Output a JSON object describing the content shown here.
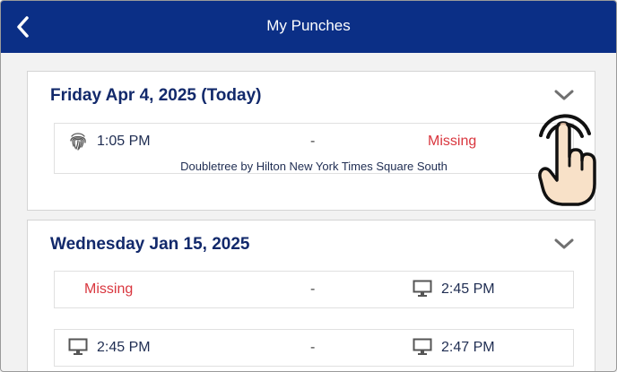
{
  "header": {
    "title": "My Punches",
    "back_icon": "chevron-left-icon"
  },
  "colors": {
    "header_bg": "#0b2f86",
    "date_text": "#12296b",
    "missing": "#d9363e"
  },
  "days": [
    {
      "date": "Friday Apr 4, 2025 (Today)",
      "expand_icon": "chevron-down-icon",
      "punches": [
        {
          "in_icon": "fingerprint-icon",
          "in_time": "1:05 PM",
          "separator": "-",
          "out_time": "Missing",
          "location": "Doubletree by Hilton New York Times Square South"
        }
      ]
    },
    {
      "date": "Wednesday Jan 15, 2025",
      "expand_icon": "chevron-down-icon",
      "punches": [
        {
          "in_time": "Missing",
          "separator": "-",
          "out_icon": "monitor-icon",
          "out_time": "2:45 PM"
        },
        {
          "in_icon": "monitor-icon",
          "in_time": "2:45 PM",
          "separator": "-",
          "out_icon": "monitor-icon",
          "out_time": "2:47 PM"
        }
      ]
    }
  ],
  "overlay": {
    "icon": "tap-hand-icon"
  }
}
